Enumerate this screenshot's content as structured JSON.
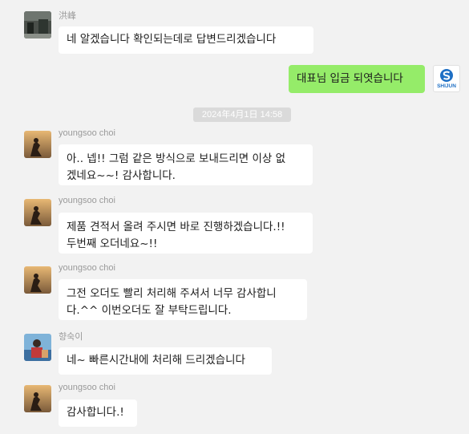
{
  "messages": [
    {
      "sender": "洪峰",
      "lines": [
        "네 알겠습니다  확인되는데로 답변드리겠습니다"
      ]
    },
    {
      "self": true,
      "logo_text": "SHIJUN",
      "lines": [
        "대표님  입금 되엿습니다"
      ]
    },
    {
      "timestamp": "2024年4月1日 14:58"
    },
    {
      "sender": "youngsoo choi",
      "lines": [
        "아.. 넵!! 그럼 같은 방식으로 보내드리면 이상 없",
        "겠네요~~! 감사합니다."
      ]
    },
    {
      "sender": "youngsoo choi",
      "lines": [
        "제품 견적서 올려 주시면 바로 진행하겠습니다.!!",
        "두번째 오더네요~!!"
      ]
    },
    {
      "sender": "youngsoo choi",
      "lines": [
        "그전 오더도 빨리 처리해 주셔서 너무 감사합니",
        "다.^^ 이번오더도 잘 부탁드립니다."
      ]
    },
    {
      "sender": "향숙이",
      "lines": [
        "네~ 빠른시간내에 처리해 드리겠습니다"
      ]
    },
    {
      "sender": "youngsoo choi",
      "lines": [
        "감사합니다.!"
      ]
    }
  ],
  "colors": {
    "background": "#f2f2f2",
    "incoming_bubble": "#ffffff",
    "outgoing_bubble": "#95ec69",
    "name_text": "#9a9a9a",
    "logo_blue": "#1e6fc4"
  }
}
